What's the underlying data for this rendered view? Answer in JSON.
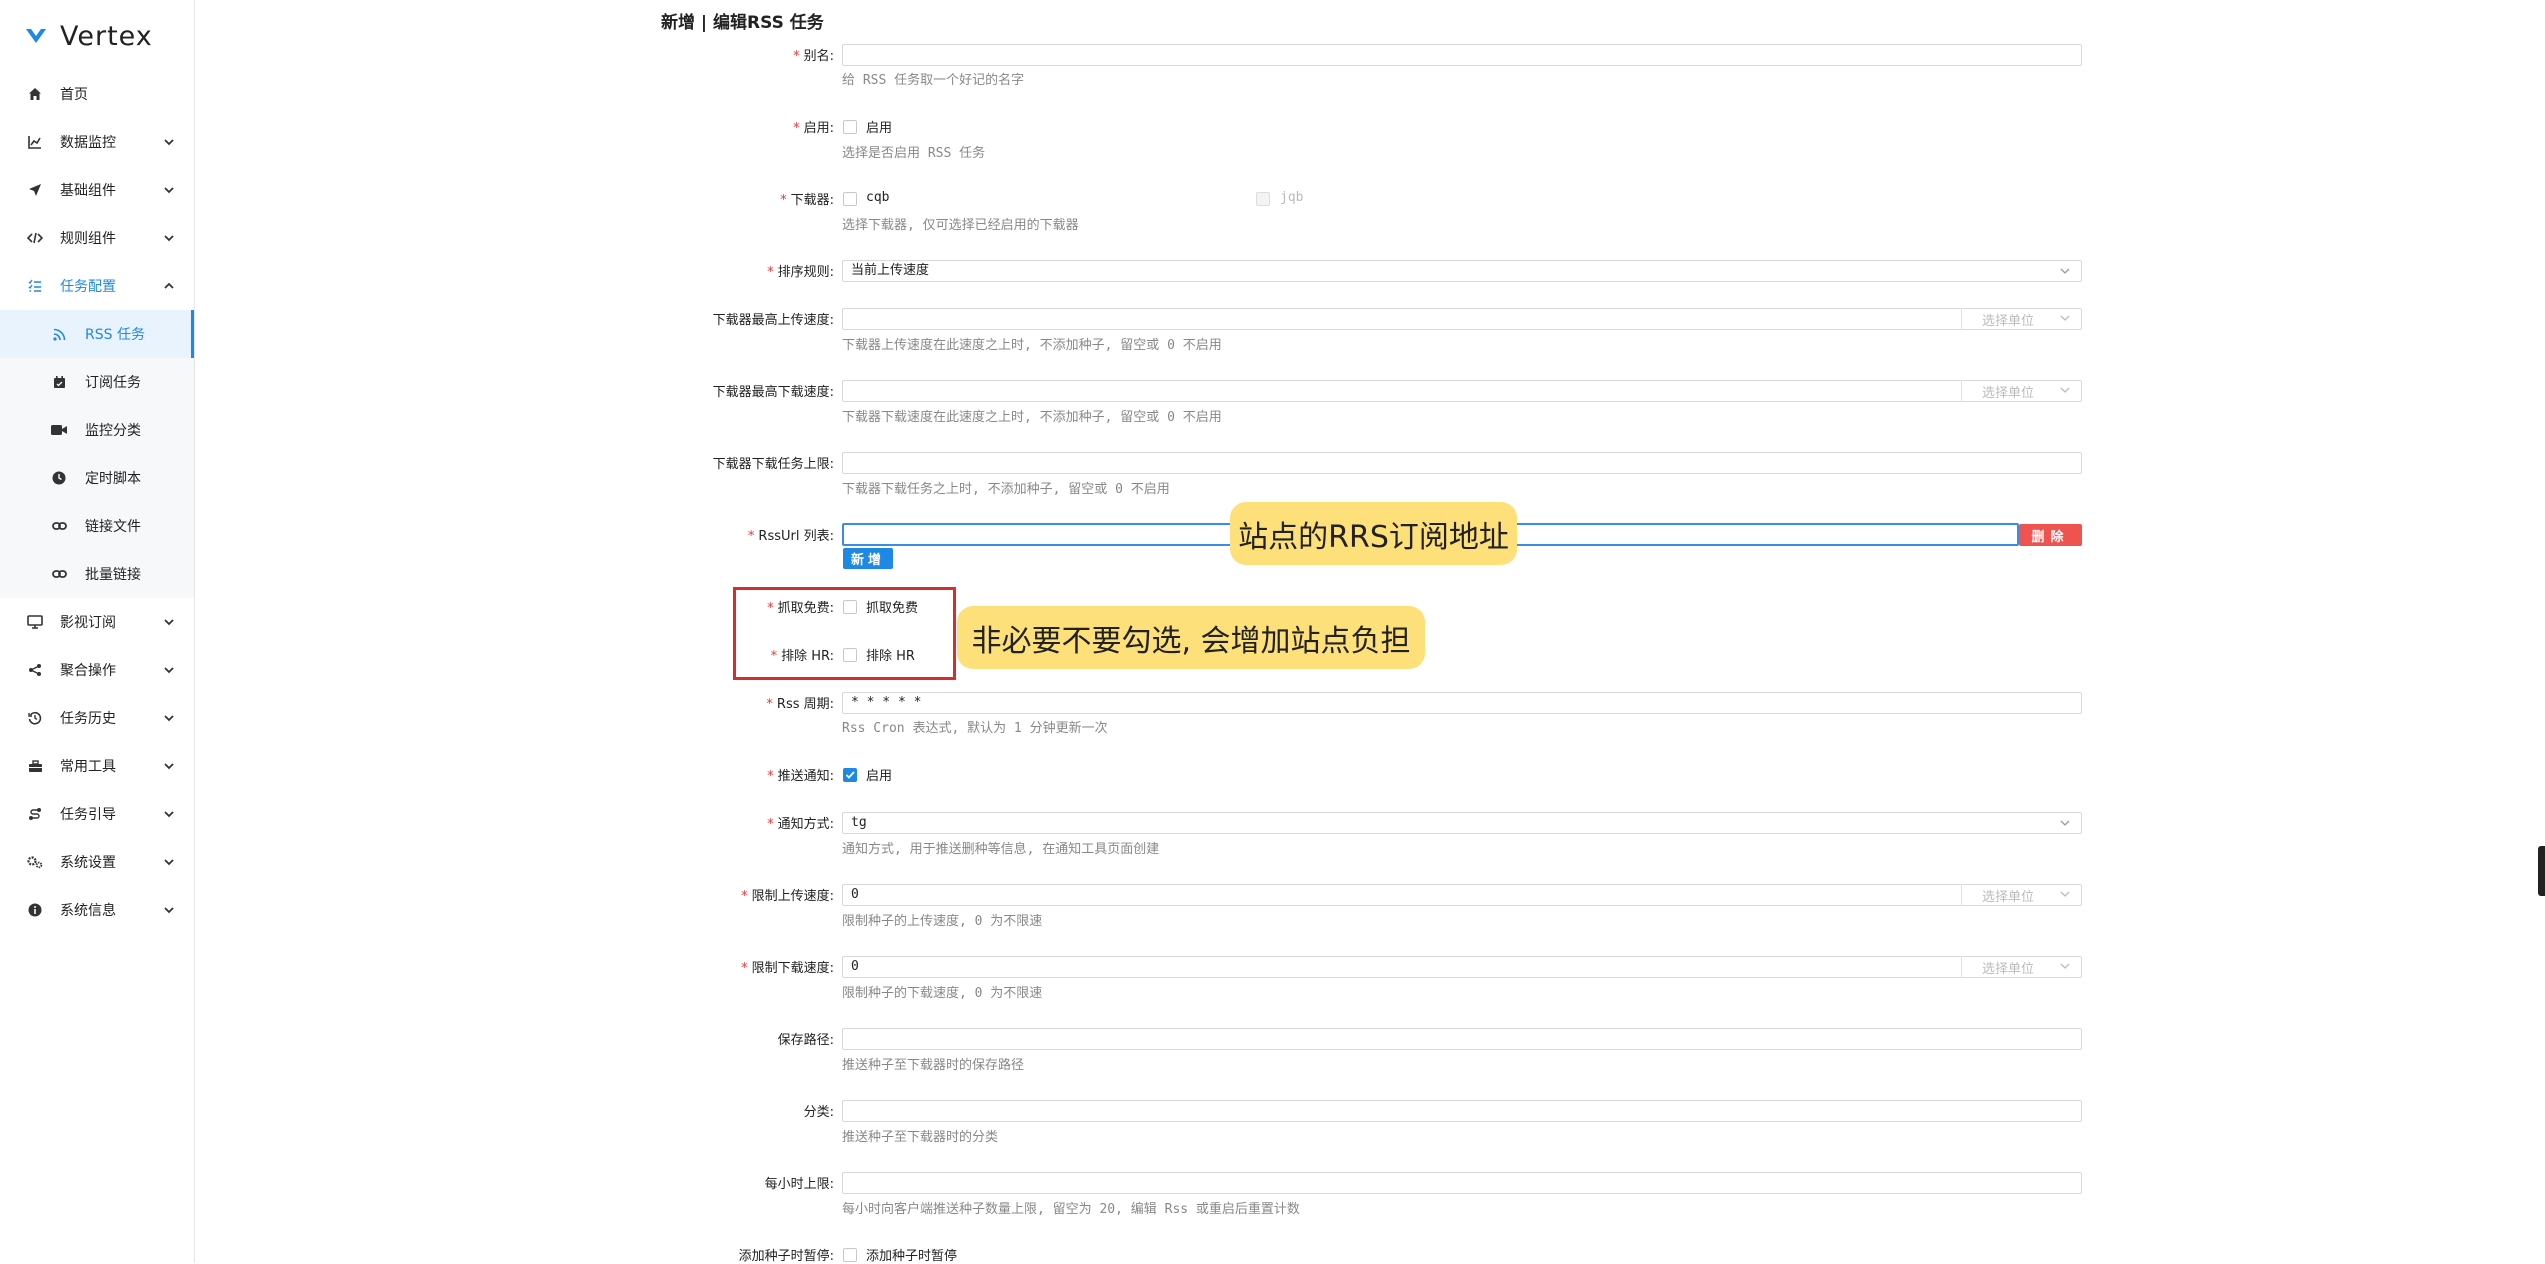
{
  "app": {
    "name": "Vertex"
  },
  "sidebar": {
    "items": [
      {
        "label": "首页",
        "icon": "home-icon"
      },
      {
        "label": "数据监控",
        "icon": "chart-line-icon"
      },
      {
        "label": "基础组件",
        "icon": "send-icon"
      },
      {
        "label": "规则组件",
        "icon": "code-icon"
      },
      {
        "label": "任务配置",
        "icon": "list-check-icon"
      },
      {
        "label": "影视订阅",
        "icon": "monitor-icon"
      },
      {
        "label": "聚合操作",
        "icon": "share-icon"
      },
      {
        "label": "任务历史",
        "icon": "history-icon"
      },
      {
        "label": "常用工具",
        "icon": "toolbox-icon"
      },
      {
        "label": "任务引导",
        "icon": "route-icon"
      },
      {
        "label": "系统设置",
        "icon": "gears-icon"
      },
      {
        "label": "系统信息",
        "icon": "info-icon"
      }
    ],
    "subitems": [
      {
        "label": "RSS 任务",
        "icon": "rss-icon"
      },
      {
        "label": "订阅任务",
        "icon": "calendar-icon"
      },
      {
        "label": "监控分类",
        "icon": "video-icon"
      },
      {
        "label": "定时脚本",
        "icon": "clock-icon"
      },
      {
        "label": "链接文件",
        "icon": "link-icon"
      },
      {
        "label": "批量链接",
        "icon": "link-icon"
      }
    ]
  },
  "form": {
    "title": "新增 | 编辑RSS 任务",
    "alias": {
      "label": "别名:",
      "value": "",
      "hint": "给 RSS 任务取一个好记的名字"
    },
    "enable": {
      "label": "启用:",
      "option": "启用",
      "hint": "选择是否启用 RSS 任务"
    },
    "downloader": {
      "label": "下载器:",
      "options": [
        "cqb",
        "jqb"
      ],
      "hint": "选择下载器, 仅可选择已经启用的下载器"
    },
    "sort_rule": {
      "label": "排序规则:",
      "value": "当前上传速度"
    },
    "max_upload": {
      "label": "下载器最高上传速度:",
      "unit": "选择单位",
      "hint": "下载器上传速度在此速度之上时, 不添加种子, 留空或 0 不启用"
    },
    "max_download": {
      "label": "下载器最高下载速度:",
      "unit": "选择单位",
      "hint": "下载器下载速度在此速度之上时, 不添加种子, 留空或 0 不启用"
    },
    "download_limit": {
      "label": "下载器下载任务上限:",
      "hint": "下载器下载任务之上时, 不添加种子, 留空或 0 不启用"
    },
    "rss_url": {
      "label": "RssUrl 列表:",
      "add": "新增",
      "delete": "删除"
    },
    "grab_free": {
      "label": "抓取免费:",
      "option": "抓取免费"
    },
    "exclude_hr": {
      "label": "排除 HR:",
      "option": "排除 HR"
    },
    "rss_cron": {
      "label": "Rss 周期:",
      "value": "* * * * *",
      "hint": "Rss Cron 表达式, 默认为 1 分钟更新一次"
    },
    "push_notify": {
      "label": "推送通知:",
      "option": "启用"
    },
    "notify_method": {
      "label": "通知方式:",
      "value": "tg",
      "hint": "通知方式, 用于推送删种等信息, 在通知工具页面创建"
    },
    "limit_upload": {
      "label": "限制上传速度:",
      "value": "0",
      "unit": "选择单位",
      "hint": "限制种子的上传速度, 0 为不限速"
    },
    "limit_download": {
      "label": "限制下载速度:",
      "value": "0",
      "unit": "选择单位",
      "hint": "限制种子的下载速度, 0 为不限速"
    },
    "save_path": {
      "label": "保存路径:",
      "hint": "推送种子至下载器时的保存路径"
    },
    "category": {
      "label": "分类:",
      "hint": "推送种子至下载器时的分类"
    },
    "hourly_limit": {
      "label": "每小时上限:",
      "hint": "每小时向客户端推送种子数量上限, 留空为 20, 编辑 Rss 或重启后重置计数"
    },
    "pause_on_add": {
      "label": "添加种子时暂停:",
      "option": "添加种子时暂停"
    }
  },
  "annotations": {
    "rss_callout": "站点的RRS订阅地址",
    "free_callout": "非必要不要勾选, 会增加站点负担"
  },
  "colors": {
    "accent": "#1e88e5",
    "danger": "#ef5350",
    "required": "#e53935",
    "callout": "#fde07a",
    "highlight_box": "#d32f2f"
  }
}
